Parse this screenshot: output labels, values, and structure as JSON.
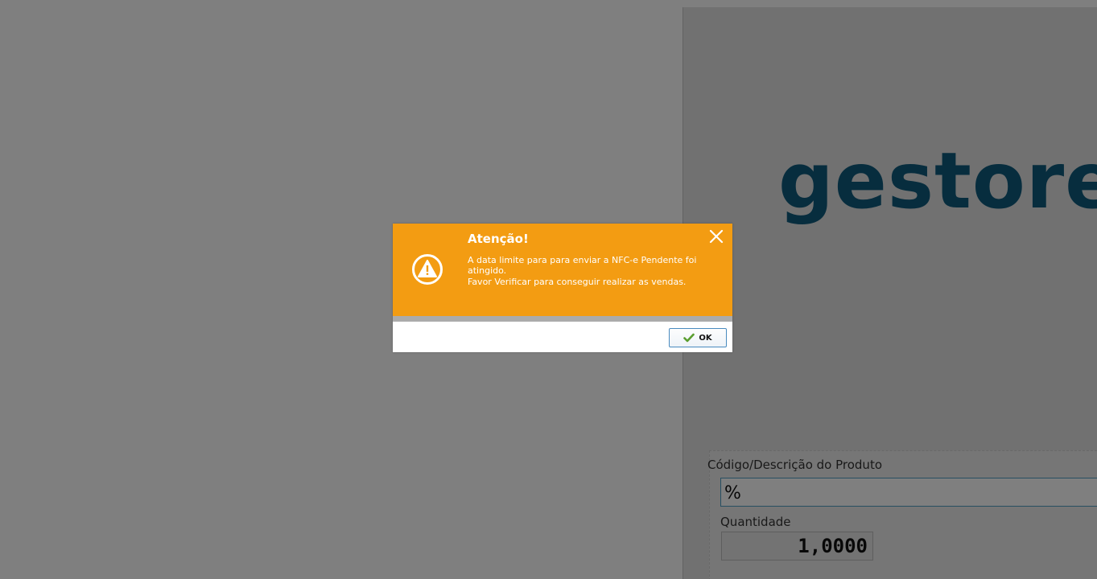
{
  "background": {
    "logo_text": "gestore",
    "logo_color": "#0e5a7c",
    "product": {
      "label": "Código/Descrição do Produto",
      "value": "%"
    },
    "quantity": {
      "label": "Quantidade",
      "value": "1,0000"
    }
  },
  "dialog": {
    "title": "Atenção!",
    "message_lines": [
      "A data limite para para enviar a NFC-e Pendente foi",
      "atingido.",
      "Favor Verificar para conseguir realizar as vendas."
    ],
    "ok_label": "OK",
    "header_color": "#f39c12",
    "icons": {
      "warning": "warning-triangle-icon",
      "close": "close-icon",
      "check": "check-icon"
    }
  }
}
